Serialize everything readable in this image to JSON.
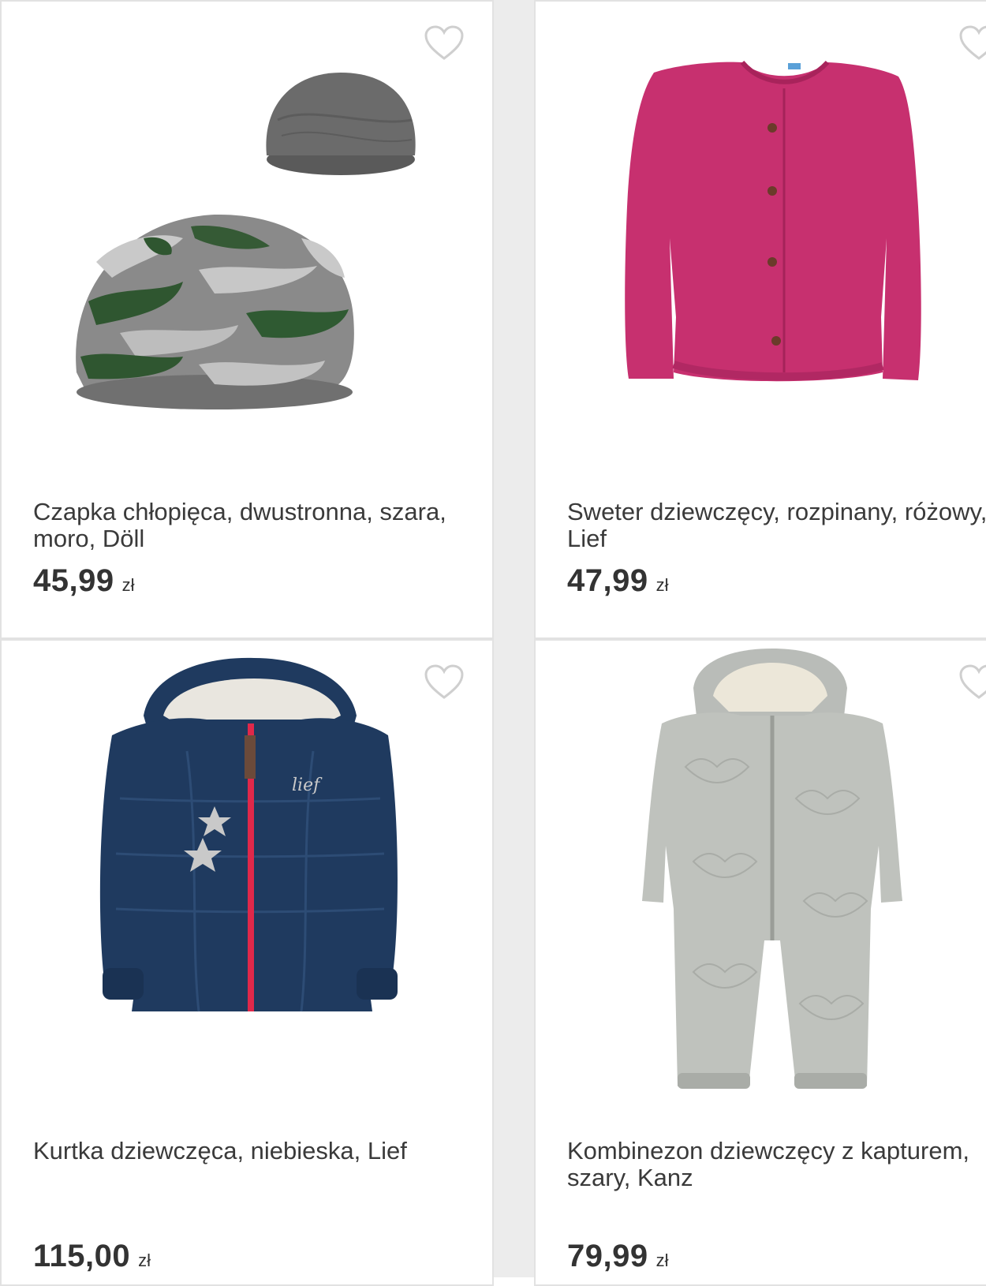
{
  "products": [
    {
      "title": "Czapka chłopięca, dwustronna, szara, moro, Döll",
      "price": "45,99",
      "currency": "zł",
      "image_icon": "camo-beanie-image",
      "favorite_icon": "heart-outline-icon"
    },
    {
      "title": "Sweter dziewczęcy, rozpinany, różowy, Lief",
      "price": "47,99",
      "currency": "zł",
      "image_icon": "pink-cardigan-image",
      "favorite_icon": "heart-outline-icon"
    },
    {
      "title": "Kurtka dziewczęca, niebieska, Lief",
      "price": "115,00",
      "currency": "zł",
      "image_icon": "navy-jacket-image",
      "favorite_icon": "heart-outline-icon"
    },
    {
      "title": "Kombinezon dziewczęcy z kapturem, szary, Kanz",
      "price": "79,99",
      "currency": "zł",
      "image_icon": "grey-snowsuit-image",
      "favorite_icon": "heart-outline-icon"
    }
  ],
  "colors": {
    "text": "#3a3a3a",
    "price": "#333333",
    "heart_outline": "#cfcfcf",
    "card_border": "#e2e2e2",
    "page_gap": "#ececec"
  }
}
